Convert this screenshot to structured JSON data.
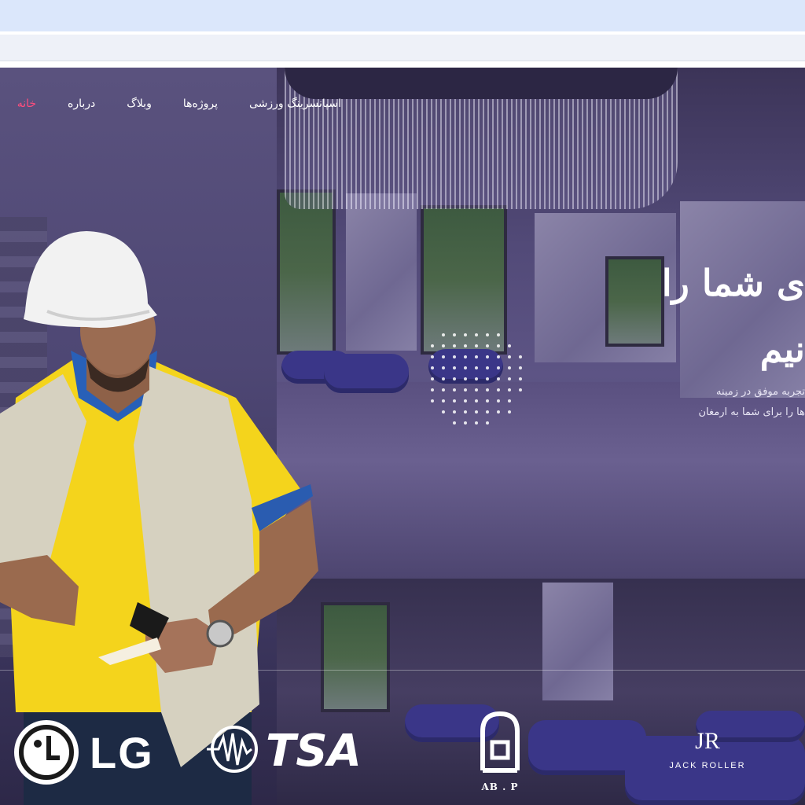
{
  "nav": {
    "items": [
      {
        "label": "خانه",
        "active": true
      },
      {
        "label": "درباره",
        "active": false
      },
      {
        "label": "وبلاگ",
        "active": false
      },
      {
        "label": "پروژه‌ها",
        "active": false
      },
      {
        "label": "اسپانسرینگ ورزشی",
        "active": false
      }
    ],
    "active_color": "#ff4d7d"
  },
  "hero": {
    "title_lines": [
      "ی شما را",
      "نیم"
    ],
    "text_lines": [
      "تجربه موفق در زمینه",
      "ها را برای شما به ارمغان"
    ]
  },
  "logos": {
    "lg": "LG",
    "tsa": "TSA",
    "abp": "AB . P",
    "jr_mark": "JR",
    "jr_name": "JACK ROLLER"
  },
  "colors": {
    "overlay": "#3d3560",
    "shirt": "#f6d61e",
    "vest": "#d8d3c2",
    "helmet": "#f2f2f2"
  }
}
